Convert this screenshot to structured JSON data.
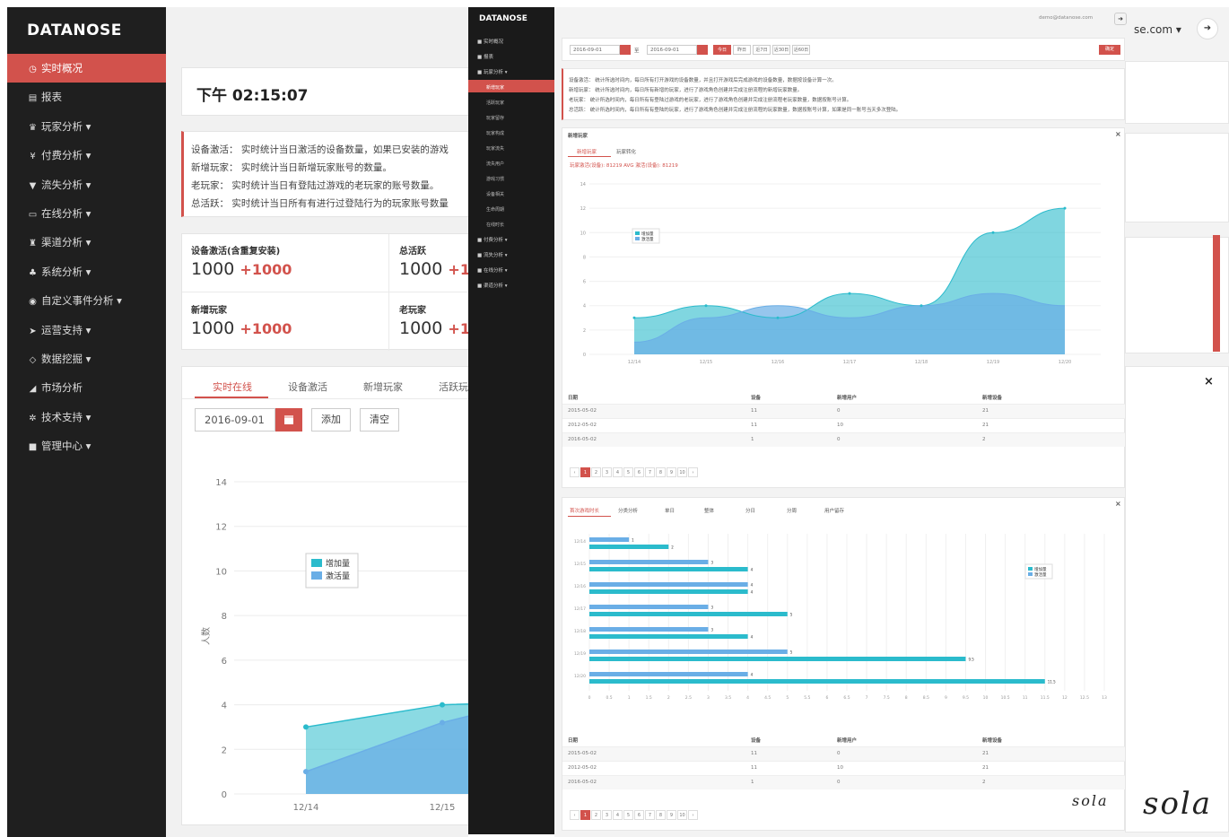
{
  "left_app": {
    "brand": "DATANOSE",
    "menu": [
      {
        "label": "实时概况",
        "icon": "clock-icon",
        "glyph": "◷",
        "active": true
      },
      {
        "label": "报表",
        "icon": "report-icon",
        "glyph": "▤",
        "active": false
      },
      {
        "label": "玩家分析",
        "icon": "users-icon",
        "glyph": "♛",
        "active": false,
        "caret": "▾"
      },
      {
        "label": "付费分析",
        "icon": "yen-icon",
        "glyph": "¥",
        "active": false,
        "caret": "▾"
      },
      {
        "label": "流失分析",
        "icon": "funnel-icon",
        "glyph": "▼",
        "active": false,
        "caret": "▾"
      },
      {
        "label": "在线分析",
        "icon": "monitor-icon",
        "glyph": "▭",
        "active": false,
        "caret": "▾"
      },
      {
        "label": "渠道分析",
        "icon": "car-icon",
        "glyph": "♜",
        "active": false,
        "caret": "▾"
      },
      {
        "label": "系统分析",
        "icon": "sitemap-icon",
        "glyph": "♣",
        "active": false,
        "caret": "▾"
      },
      {
        "label": "自定义事件分析",
        "icon": "dot-circle-icon",
        "glyph": "◉",
        "active": false,
        "caret": "▾"
      },
      {
        "label": "运营支持",
        "icon": "plane-icon",
        "glyph": "➤",
        "active": false,
        "caret": "▾"
      },
      {
        "label": "数据挖掘",
        "icon": "diamond-icon",
        "glyph": "◇",
        "active": false,
        "caret": "▾"
      },
      {
        "label": "市场分析",
        "icon": "signal-icon",
        "glyph": "◢",
        "active": false
      },
      {
        "label": "技术支持",
        "icon": "cogs-icon",
        "glyph": "✲",
        "active": false,
        "caret": "▾"
      },
      {
        "label": "管理中心",
        "icon": "briefcase-icon",
        "glyph": "■",
        "active": false,
        "caret": "▾"
      }
    ],
    "clock": "下午 02:15:07",
    "notes": [
      "设备激活： 实时统计当日激活的设备数量，如果已安装的游戏",
      "新增玩家： 实时统计当日新增玩家账号的数量。",
      "老玩家： 实时统计当日有登陆过游戏的老玩家的账号数量。",
      "总活跃： 实时统计当日所有有进行过登陆行为的玩家账号数量"
    ],
    "stats": [
      {
        "label": "设备激活(含重复安装)",
        "value": "1000",
        "increment": "+1000"
      },
      {
        "label": "总活跃",
        "value": "1000",
        "increment": "+1000"
      },
      {
        "label": "新增玩家",
        "value": "1000",
        "increment": "+1000"
      },
      {
        "label": "老玩家",
        "value": "1000",
        "increment": "+1000"
      }
    ],
    "tabs": [
      "实时在线",
      "设备激活",
      "新增玩家",
      "活跃玩家"
    ],
    "date_value": "2016-09-01",
    "add_label": "添加",
    "clear_label": "清空",
    "colors": {
      "accent": "#d2524c",
      "sidebar": "#1f1f1f",
      "series_a": "#2bbbcc",
      "series_b": "#6aaee6"
    }
  },
  "chart_data": {
    "type": "area",
    "ylabel": "人数",
    "ylim": [
      0,
      14
    ],
    "yticks": [
      0,
      2,
      4,
      6,
      8,
      10,
      12,
      14
    ],
    "x": [
      "12/14",
      "12/15"
    ],
    "legend_position": "top-left",
    "series": [
      {
        "name": "增加量",
        "values": [
          3,
          4
        ]
      },
      {
        "name": "激活量",
        "values": [
          1,
          3.2
        ]
      }
    ]
  },
  "right_app": {
    "brand": "DATANOSE",
    "email": "demo@datanose.com",
    "email_partial": "se.com ▾",
    "menu": [
      {
        "label": "实时概况",
        "top": false
      },
      {
        "label": "报表",
        "top": false
      },
      {
        "label": "玩家分析 ▾",
        "top": false
      }
    ],
    "submenu": [
      "新增玩家",
      "活跃玩家",
      "玩家留存",
      "玩家构成",
      "玩家流失",
      "流失用户",
      "游戏习惯",
      "设备相关",
      "生命周期",
      "在线时长"
    ],
    "menu_after": [
      "付费分析 ▾",
      "流失分析 ▾",
      "在线分析 ▾",
      "渠道分析 ▾"
    ],
    "date_from": "2016-09-01",
    "date_to": "2016-09-01",
    "filter_labels": [
      "今日",
      "昨日",
      "近7日",
      "近30日",
      "近60日"
    ],
    "filter_btn": "确定",
    "notes": [
      "设备激活： 统计所选时间内，每日所有打开游戏的设备数量，并且打开游戏后完成游戏的设备数量，数据按设备计算一次。",
      "新增玩家： 统计所选时间内，每日所有新增的玩家，进行了游戏角色创建并完成注册流程的新增玩家数量。",
      "老玩家： 统计所选时间内，每日所有有登陆过游戏的老玩家，进行了游戏角色创建并完成注册流程老玩家数量，数据按账号计算。",
      "总活跃： 统计所选时间内，每日所有有登陆的玩家，进行了游戏角色创建并完成注册流程的玩家数量，数据按账号计算，如果是同一账号当天多次登陆。"
    ],
    "panel1_title": "新增玩家",
    "panel1_tabs": [
      "新增玩家",
      "玩家转化"
    ],
    "summary": "玩家激活(设备): 81219   AVG 激活(设备): 81219",
    "area_chart": {
      "yticks": [
        "0",
        "2",
        "4",
        "6",
        "8",
        "10",
        "12",
        "14"
      ],
      "xticks": [
        "12/14",
        "12/15",
        "12/16",
        "12/17",
        "12/18",
        "12/19",
        "12/20"
      ],
      "legend": [
        "增加量",
        "激活量"
      ],
      "series_a": [
        3,
        4,
        3,
        5,
        4,
        10,
        12
      ],
      "series_b": [
        1,
        3,
        4,
        3,
        4,
        5,
        4
      ]
    },
    "table_headers": [
      "日期",
      "设备",
      "新增用户",
      "新增设备"
    ],
    "table_rows": [
      [
        "2015-05-02",
        "11",
        "0",
        "21"
      ],
      [
        "2012-05-02",
        "11",
        "10",
        "21"
      ],
      [
        "2016-05-02",
        "1",
        "0",
        "2"
      ]
    ],
    "pages": [
      "‹",
      "1",
      "2",
      "3",
      "4",
      "5",
      "6",
      "7",
      "8",
      "9",
      "10",
      "›"
    ],
    "panel2_tabs": [
      "首次游戏时长",
      "分类分析",
      "单日",
      "整体",
      "分日",
      "分周",
      "用户留存"
    ],
    "bar_chart": {
      "categories": [
        "12/14",
        "12/15",
        "12/16",
        "12/17",
        "12/18",
        "12/19",
        "12/20"
      ],
      "series_a": [
        4,
        8,
        8,
        10,
        8,
        19,
        23
      ],
      "series_b": [
        2,
        6,
        8,
        6,
        6,
        10,
        8
      ],
      "xticks": [
        "0",
        "0.5",
        "1",
        "1.5",
        "2",
        "2.5",
        "3",
        "3.5",
        "4",
        "4.5",
        "5",
        "5.5",
        "6",
        "6.5",
        "7",
        "7.5",
        "8",
        "8.5",
        "9",
        "9.5",
        "10",
        "10.5",
        "11",
        "11.5",
        "12",
        "12.5",
        "13"
      ],
      "legend": [
        "增加量",
        "激活量"
      ]
    },
    "sola_small": "sola",
    "sola_big": "sola"
  }
}
